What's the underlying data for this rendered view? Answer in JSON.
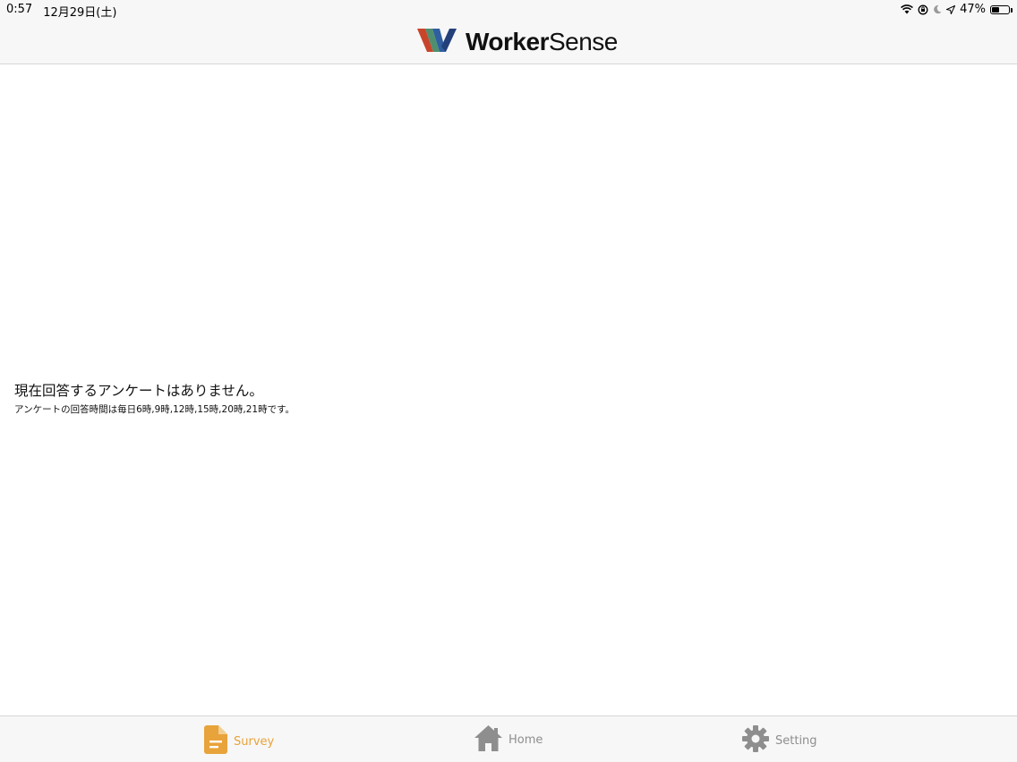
{
  "status_bar": {
    "time": "0:57",
    "date": "12月29日(土)",
    "battery_percent_label": "47%",
    "battery_level": 0.47
  },
  "header": {
    "brand_bold": "Worker",
    "brand_light": "Sense"
  },
  "main": {
    "message": "現在回答するアンケートはありません。",
    "sub_message": "アンケートの回答時間は毎日6時,9時,12時,15時,20時,21時です。"
  },
  "tab_bar": {
    "tabs": [
      {
        "label": "Survey",
        "icon": "document-icon",
        "active": true
      },
      {
        "label": "Home",
        "icon": "home-icon",
        "active": false
      },
      {
        "label": "Setting",
        "icon": "gear-icon",
        "active": false
      }
    ]
  },
  "colors": {
    "accent": "#e8a33a",
    "inactive": "#8e8e8e",
    "bar_background": "#f7f7f7"
  }
}
